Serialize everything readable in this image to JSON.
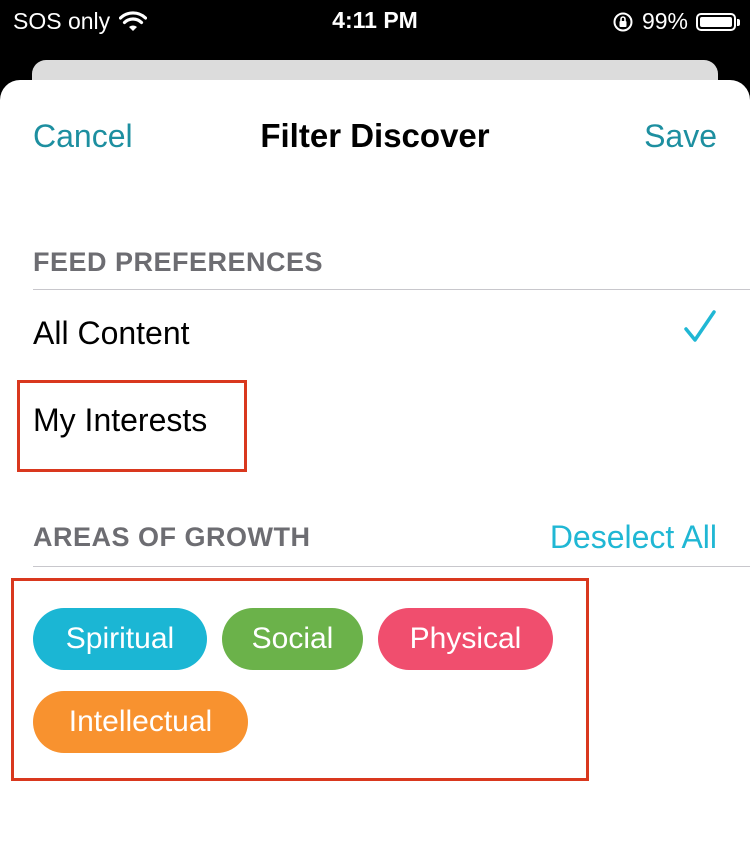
{
  "status_bar": {
    "carrier": "SOS only",
    "time": "4:11 PM",
    "battery_percent": "99%",
    "wifi_icon": "wifi-icon",
    "orientation_lock_icon": "orientation-lock-icon",
    "battery_icon": "battery-icon"
  },
  "nav": {
    "cancel_label": "Cancel",
    "title": "Filter Discover",
    "save_label": "Save"
  },
  "feed_preferences": {
    "header": "FEED PREFERENCES",
    "options": [
      {
        "label": "All Content",
        "selected": true
      },
      {
        "label": "My Interests",
        "selected": false
      }
    ]
  },
  "areas_of_growth": {
    "header": "AREAS OF GROWTH",
    "deselect_label": "Deselect All",
    "chips": [
      {
        "label": "Spiritual",
        "color": "#1bb6d4"
      },
      {
        "label": "Social",
        "color": "#6bb24a"
      },
      {
        "label": "Physical",
        "color": "#f04e6e"
      },
      {
        "label": "Intellectual",
        "color": "#f8922f"
      }
    ]
  },
  "colors": {
    "accent_teal": "#1d8fa0",
    "accent_cyan": "#20b7d4",
    "highlight_red": "#d9381e"
  }
}
